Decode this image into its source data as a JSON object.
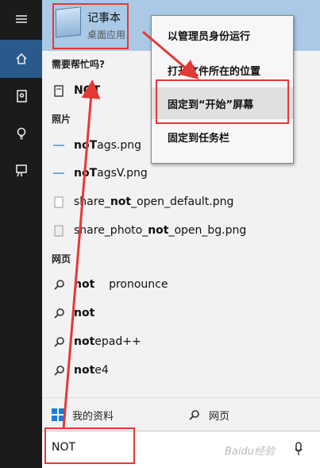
{
  "rail": {
    "items": [
      "home",
      "notebook",
      "ideas",
      "feedback"
    ]
  },
  "best_match": {
    "title": "记事本",
    "subtitle": "桌面应用"
  },
  "sections": {
    "help": "需要帮忙吗?",
    "photos": "照片",
    "web": "网页"
  },
  "help_item": {
    "bold": "NOT",
    "rest": ""
  },
  "photos": [
    {
      "pre": "",
      "bold": "noT",
      "post": "ags.png"
    },
    {
      "pre": "",
      "bold": "noT",
      "post": "agsV.png"
    },
    {
      "pre": "share_",
      "bold": "not",
      "post": "_open_default.png"
    },
    {
      "pre": "share_photo_",
      "bold": "not",
      "post": "_open_bg.png"
    }
  ],
  "web": [
    {
      "bold": "not",
      "rest": "    pronounce"
    },
    {
      "bold": "not",
      "rest": ""
    },
    {
      "bold": "not",
      "rest": "epad++"
    },
    {
      "bold": "not",
      "rest": "e4"
    }
  ],
  "context_menu": {
    "items": [
      "以管理员身份运行",
      "打开文件所在的位置",
      "固定到“开始”屏幕",
      "固定到任务栏"
    ]
  },
  "bottom_tabs": {
    "my_stuff": "我的资料",
    "web": "网页"
  },
  "search": {
    "value": "NOT"
  },
  "watermark": "Baidu经验",
  "colors": {
    "accent": "#2a5a8c",
    "highlight": "#a9c9e6",
    "annotation": "#e53935"
  }
}
